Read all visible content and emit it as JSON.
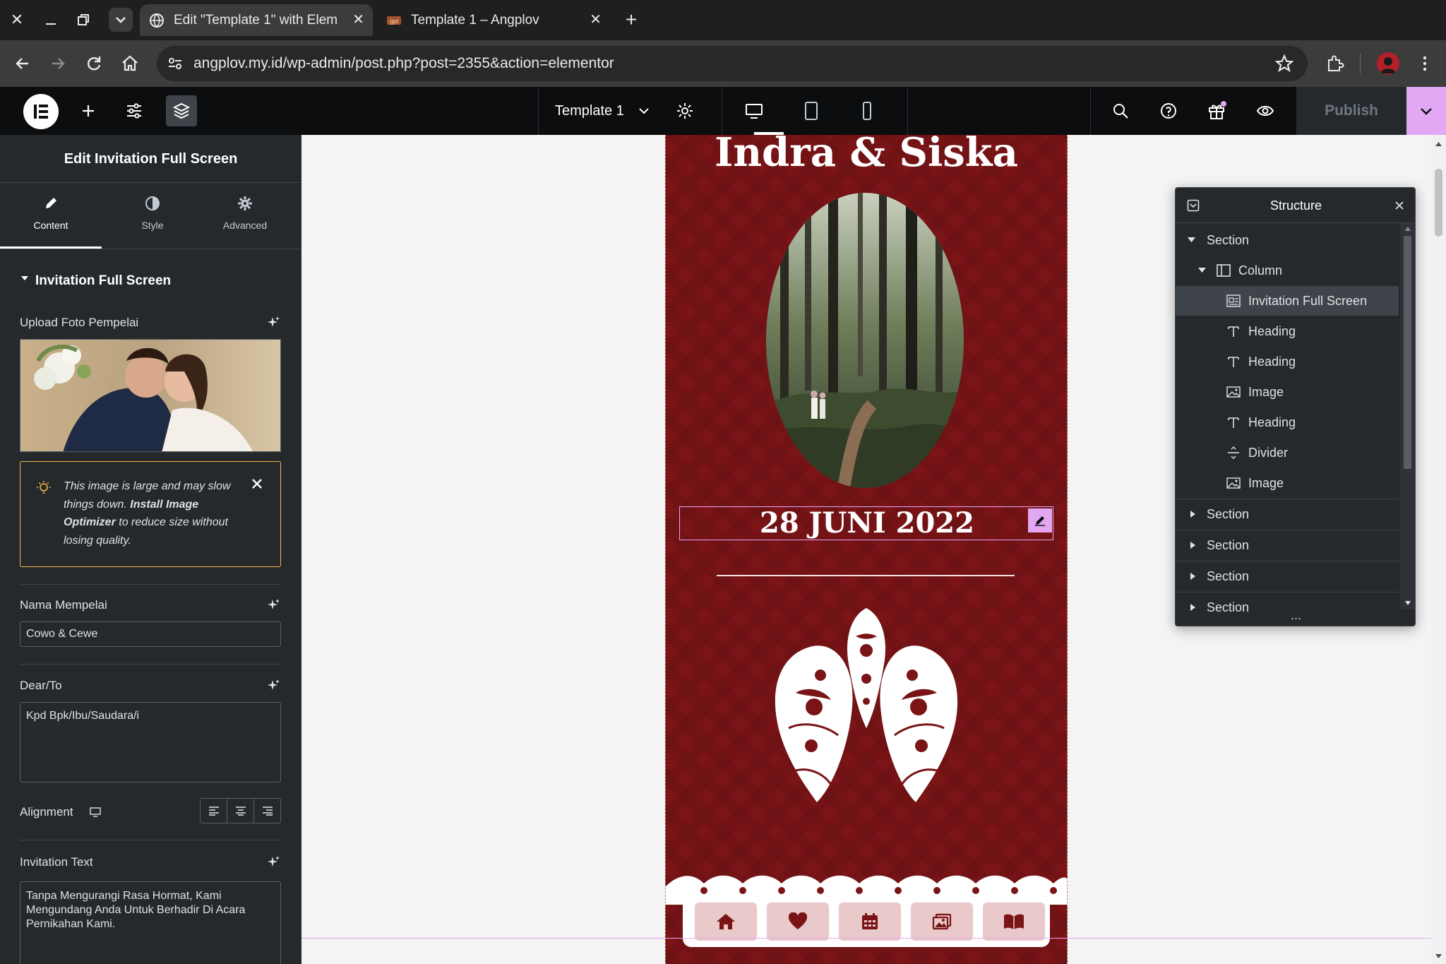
{
  "browser": {
    "tabs": [
      {
        "title": "Edit \"Template 1\" with Elem"
      },
      {
        "title": "Template 1 – Angplov"
      }
    ],
    "url": "angplov.my.id/wp-admin/post.php?post=2355&action=elementor"
  },
  "editor": {
    "document_name": "Template 1",
    "publish_label": "Publish"
  },
  "panel": {
    "title": "Edit Invitation Full Screen",
    "tabs": [
      {
        "label": "Content"
      },
      {
        "label": "Style"
      },
      {
        "label": "Advanced"
      }
    ],
    "section_title": "Invitation Full Screen",
    "upload_label": "Upload Foto Pempelai",
    "notice_before": "This image is large and may slow things down. ",
    "notice_strong": "Install Image Optimizer",
    "notice_after": " to reduce size without losing quality.",
    "nama_label": "Nama Mempelai",
    "nama_value": "Cowo & Cewe",
    "dear_label": "Dear/To",
    "dear_value": "Kpd Bpk/Ibu/Saudara/i",
    "alignment_label": "Alignment",
    "invitation_label": "Invitation Text",
    "invitation_value": "Tanpa Mengurangi Rasa Hormat, Kami Mengundang Anda Untuk Berhadir Di Acara Pernikahan Kami."
  },
  "preview": {
    "couple_name": "Indra & Siska",
    "date": "28 JUNI 2022",
    "accent": "#7a1417",
    "nav_icons": [
      "home-icon",
      "heart-icon",
      "calendar-icon",
      "gallery-icon",
      "book-icon"
    ]
  },
  "structure": {
    "title": "Structure",
    "items": [
      {
        "label": "Section",
        "icon": "caret-down"
      },
      {
        "label": "Column",
        "icon": "column-icon"
      },
      {
        "label": "Invitation Full Screen",
        "icon": "widget-icon"
      },
      {
        "label": "Heading",
        "icon": "heading-icon"
      },
      {
        "label": "Heading",
        "icon": "heading-icon"
      },
      {
        "label": "Image",
        "icon": "image-icon"
      },
      {
        "label": "Heading",
        "icon": "heading-icon"
      },
      {
        "label": "Divider",
        "icon": "divider-icon"
      },
      {
        "label": "Image",
        "icon": "image-icon"
      },
      {
        "label": "Section",
        "icon": "caret-right"
      },
      {
        "label": "Section",
        "icon": "caret-right"
      },
      {
        "label": "Section",
        "icon": "caret-right"
      },
      {
        "label": "Section",
        "icon": "caret-right"
      }
    ],
    "more": "..."
  }
}
